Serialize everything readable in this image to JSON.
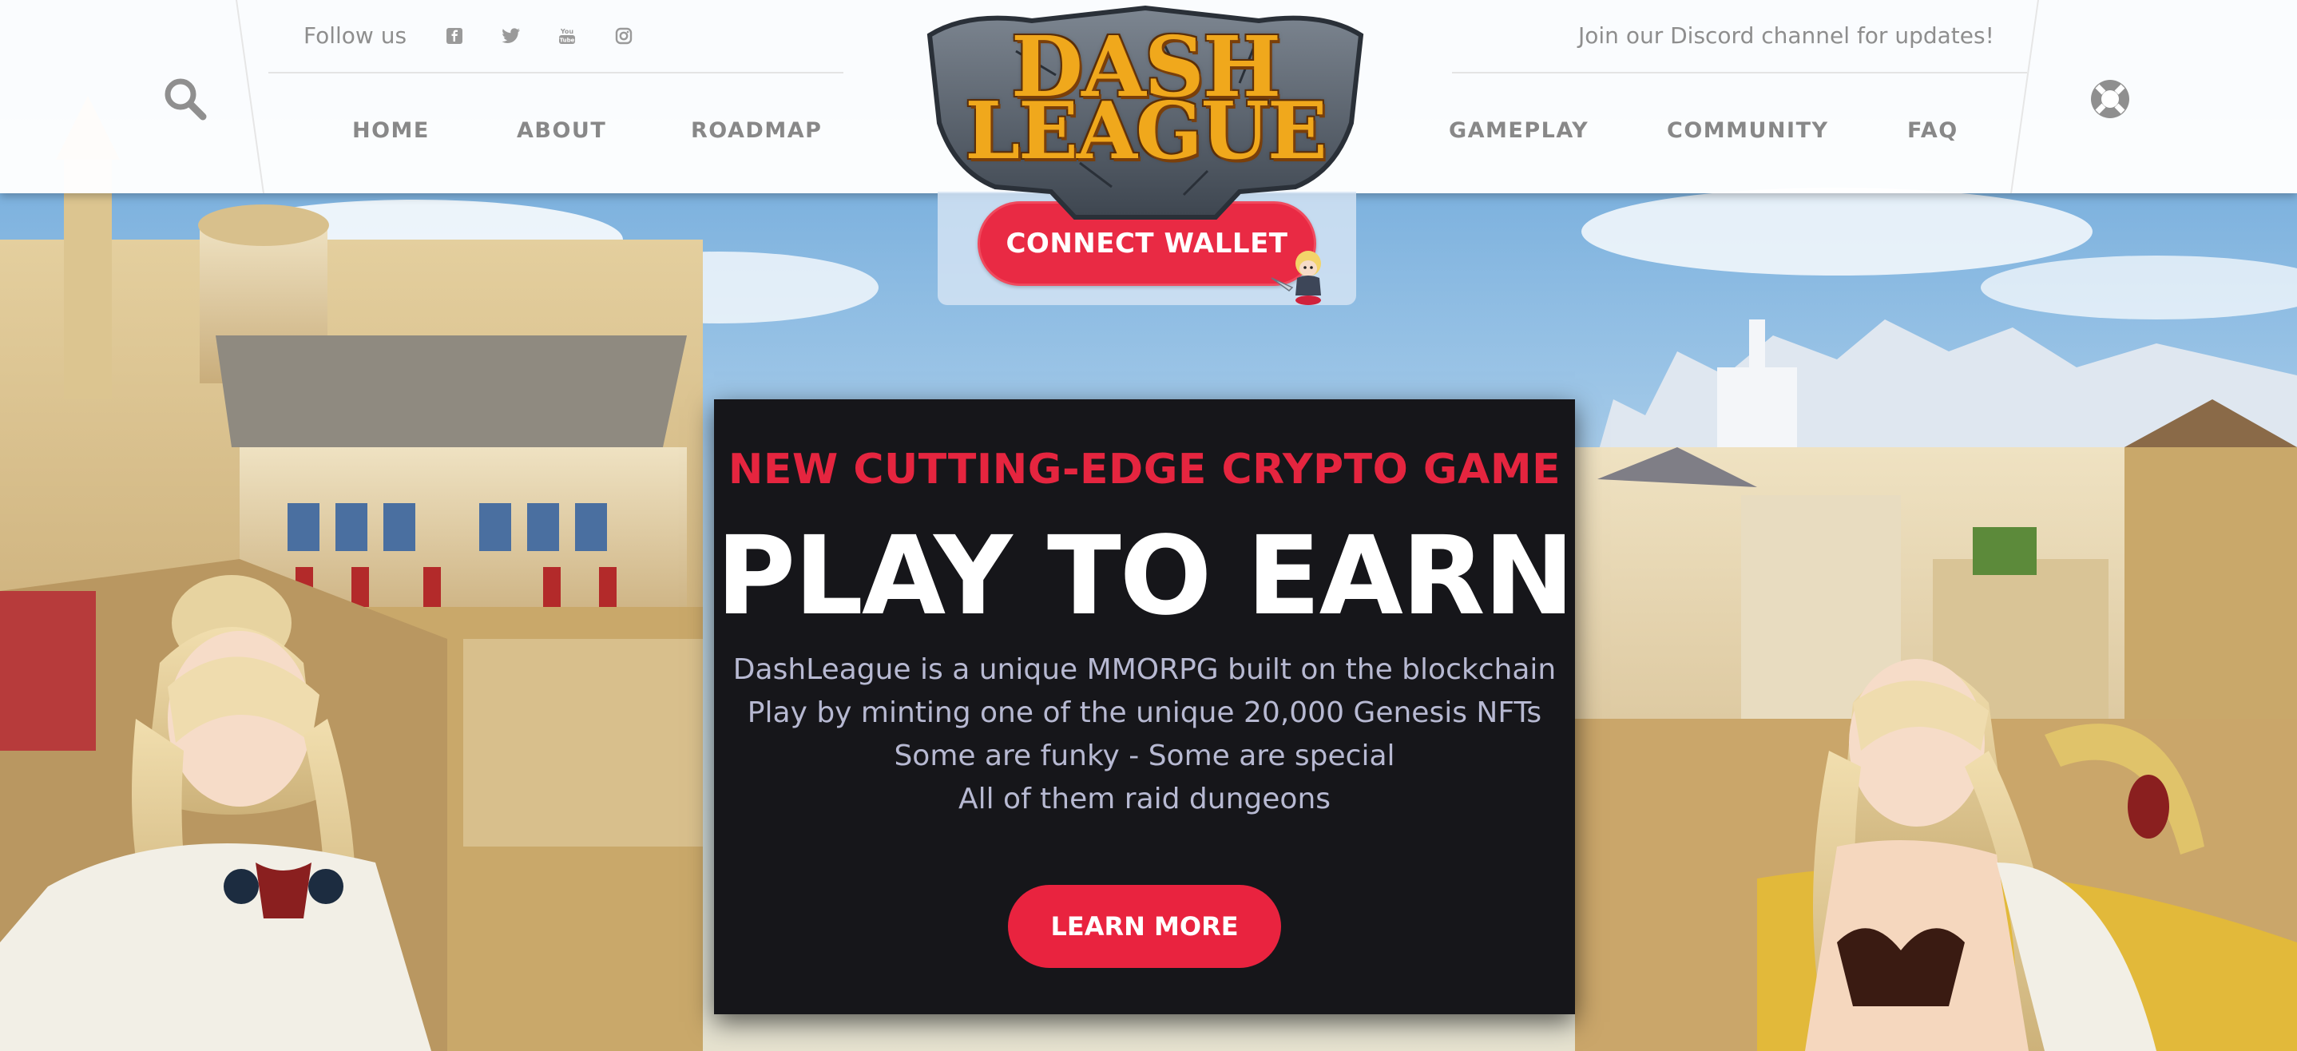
{
  "header": {
    "follow_label": "Follow us",
    "social_icons": [
      "facebook-icon",
      "twitter-icon",
      "youtube-icon",
      "instagram-icon"
    ],
    "discord_note": "Join our Discord channel for updates!"
  },
  "nav": {
    "left": [
      "HOME",
      "ABOUT",
      "ROADMAP"
    ],
    "right": [
      "GAMEPLAY",
      "COMMUNITY",
      "FAQ"
    ]
  },
  "logo": {
    "line1": "DASH",
    "line2": "LEAGUE"
  },
  "wallet": {
    "label": "CONNECT WALLET"
  },
  "hero": {
    "kicker": "NEW CUTTING-EDGE CRYPTO GAME",
    "title": "PLAY TO EARN",
    "lines": [
      "DashLeague is a unique MMORPG built on the blockchain",
      "Play by minting one of the unique 20,000 Genesis NFTs",
      "Some are funky - Some are special",
      "All of them raid dungeons"
    ],
    "cta": "LEARN MORE"
  },
  "colors": {
    "accent": "#e9233f",
    "panel": "#16161a",
    "logo_gold": "#f0a81c",
    "nav_text": "#888888"
  }
}
